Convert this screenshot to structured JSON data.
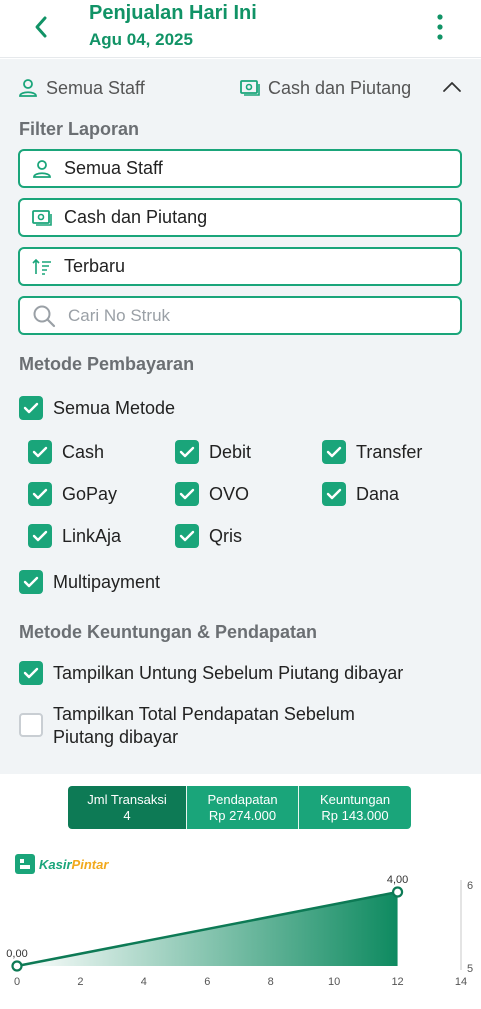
{
  "header": {
    "title": "Penjualan Hari Ini",
    "date": "Agu 04, 2025"
  },
  "summary": {
    "staff": "Semua Staff",
    "payment": "Cash dan Piutang"
  },
  "filter": {
    "heading": "Filter Laporan",
    "staff_value": "Semua Staff",
    "payment_value": "Cash dan Piutang",
    "sort_value": "Terbaru",
    "search_placeholder": "Cari No Struk"
  },
  "payment_methods": {
    "heading": "Metode Pembayaran",
    "all": {
      "label": "Semua Metode",
      "checked": true
    },
    "items": [
      {
        "label": "Cash",
        "checked": true
      },
      {
        "label": "Debit",
        "checked": true
      },
      {
        "label": "Transfer",
        "checked": true
      },
      {
        "label": "GoPay",
        "checked": true
      },
      {
        "label": "OVO",
        "checked": true
      },
      {
        "label": "Dana",
        "checked": true
      },
      {
        "label": "LinkAja",
        "checked": true
      },
      {
        "label": "Qris",
        "checked": true
      }
    ],
    "multipayment": {
      "label": "Multipayment",
      "checked": true
    }
  },
  "profit_methods": {
    "heading": "Metode Keuntungan & Pendapatan",
    "options": [
      {
        "label": "Tampilkan Untung Sebelum Piutang dibayar",
        "checked": true
      },
      {
        "label": "Tampilkan Total Pendapatan Sebelum Piutang dibayar",
        "checked": false
      }
    ]
  },
  "tabs": [
    {
      "title": "Jml Transaksi",
      "value": "4",
      "active": true
    },
    {
      "title": "Pendapatan",
      "value": "Rp 274.000",
      "active": false
    },
    {
      "title": "Keuntungan",
      "value": "Rp 143.000",
      "active": false
    }
  ],
  "logo": {
    "part1": "Kasir",
    "part2": "Pintar"
  },
  "colors": {
    "primary": "#1aa57a",
    "primary_dark": "#0d7a55",
    "header_text": "#119366",
    "panel_bg": "#f1f4f6"
  },
  "chart_data": {
    "type": "area",
    "x": [
      0,
      12
    ],
    "y": [
      0,
      4
    ],
    "point_labels": [
      "0,00",
      "4,00"
    ],
    "x_ticks": [
      "0",
      "2",
      "4",
      "6",
      "8",
      "10",
      "12",
      "14"
    ],
    "xlim": [
      0,
      14
    ],
    "right_axis_ticks": [
      "6",
      "5"
    ],
    "grid": false
  }
}
